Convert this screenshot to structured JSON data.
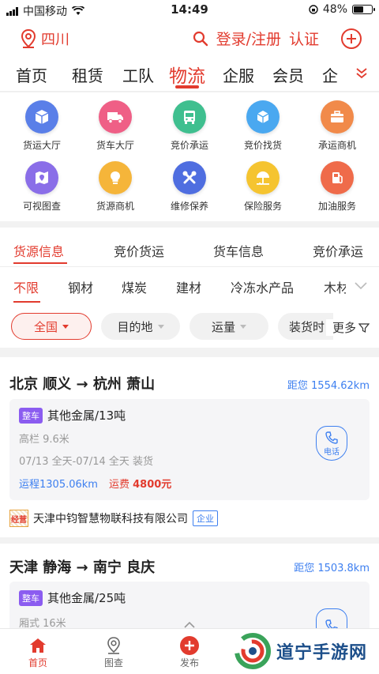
{
  "status_bar": {
    "carrier": "中国移动",
    "time": "14:49",
    "battery": "48%"
  },
  "header": {
    "location": "四川",
    "login": "登录/注册",
    "verify": "认证"
  },
  "main_nav": {
    "tabs": [
      "首页",
      "租赁",
      "工队",
      "物流",
      "企服",
      "会员",
      "企"
    ],
    "active": "物流"
  },
  "services": [
    {
      "label": "货运大厅",
      "icon": "box-icon",
      "color": "#5a7fe8"
    },
    {
      "label": "货车大厅",
      "icon": "truck-icon",
      "color": "#ef5f86"
    },
    {
      "label": "竞价承运",
      "icon": "bus-icon",
      "color": "#3fbf8f"
    },
    {
      "label": "竞价找货",
      "icon": "package-search-icon",
      "color": "#4aa8f0"
    },
    {
      "label": "承运商机",
      "icon": "briefcase-icon",
      "color": "#f18a4a"
    },
    {
      "label": "可视图查",
      "icon": "map-icon",
      "color": "#8a6ee8"
    },
    {
      "label": "货源商机",
      "icon": "lightbulb-icon",
      "color": "#f5b53a"
    },
    {
      "label": "维修保养",
      "icon": "wrench-icon",
      "color": "#4f6ee0"
    },
    {
      "label": "保险服务",
      "icon": "umbrella-icon",
      "color": "#f5c430"
    },
    {
      "label": "加油服务",
      "icon": "fuel-pump-icon",
      "color": "#ef6b4a"
    }
  ],
  "sub_tabs": {
    "items": [
      "货源信息",
      "竞价货运",
      "货车信息",
      "竞价承运"
    ],
    "active": "货源信息"
  },
  "categories": {
    "items": [
      "不限",
      "钢材",
      "煤炭",
      "建材",
      "冷冻水产品",
      "木材"
    ],
    "active": "不限"
  },
  "filters": {
    "items": [
      "全国",
      "目的地",
      "运量",
      "装货时"
    ],
    "more": "更多"
  },
  "listings": [
    {
      "route": "北京 顺义 → 杭州 萧山",
      "distance": "距您 1554.62km",
      "tag": "整车",
      "cargo": "其他金属/13吨",
      "truck": "高栏 9.6米",
      "schedule": "07/13 全天-07/14 全天 装货",
      "mileage": "运程1305.06km",
      "fee_label": "运费",
      "fee": "4800元",
      "phone_label": "电话",
      "company_badge": "经营",
      "company": "天津中钧智慧物联科技有限公司",
      "company_type": "企业"
    },
    {
      "route": "天津 静海 → 南宁 良庆",
      "distance": "距您 1503.8km",
      "tag": "整车",
      "cargo": "其他金属/25吨",
      "truck": "厢式 16米"
    }
  ],
  "bottom_nav": {
    "items": [
      "首页",
      "图查",
      "发布"
    ],
    "active": "首页"
  },
  "watermark": "道宁手游网"
}
